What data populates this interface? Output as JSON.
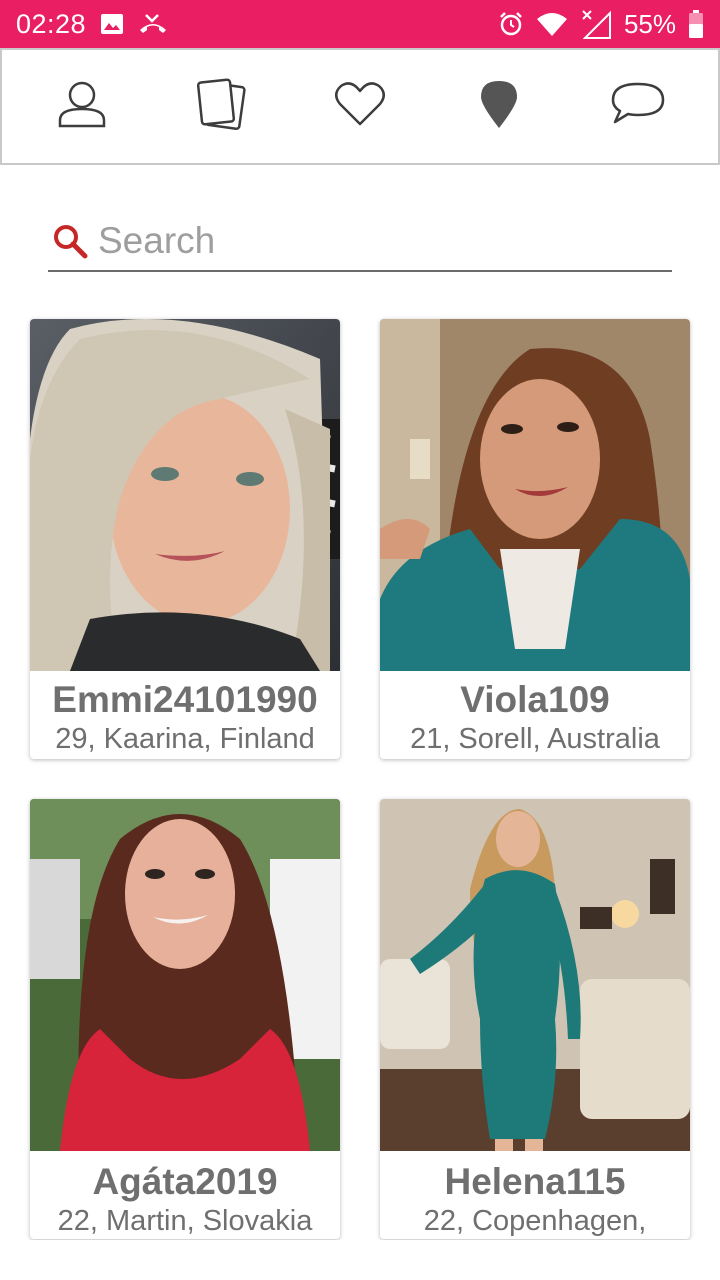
{
  "status_bar": {
    "time": "02:28",
    "battery_percent": "55%",
    "icons": [
      "image-icon",
      "missed-call-icon",
      "alarm-icon",
      "wifi-icon",
      "signal-icon",
      "battery-icon"
    ],
    "background_color": "#e91e63"
  },
  "nav": {
    "items": [
      {
        "icon": "profile-icon"
      },
      {
        "icon": "cards-icon"
      },
      {
        "icon": "heart-icon"
      },
      {
        "icon": "location-pin-icon"
      },
      {
        "icon": "chat-icon"
      }
    ]
  },
  "search": {
    "placeholder": "Search",
    "value": "",
    "icon_color": "#c62828"
  },
  "profiles": [
    {
      "name": "Emmi24101990",
      "info": "29, Kaarina, Finland"
    },
    {
      "name": "Viola109",
      "info": "21, Sorell, Australia"
    },
    {
      "name": "Agáta2019",
      "info": "22, Martin, Slovakia"
    },
    {
      "name": "Helena115",
      "info": "22, Copenhagen,"
    }
  ]
}
